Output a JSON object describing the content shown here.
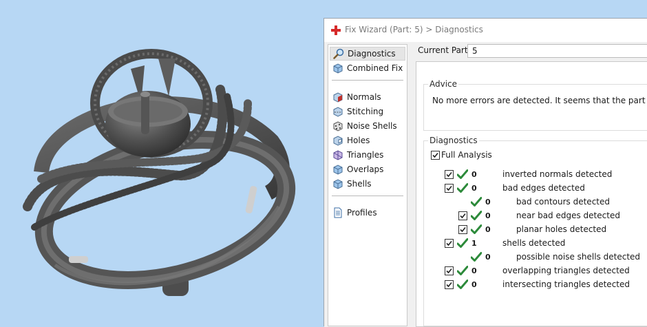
{
  "window": {
    "title": "Fix Wizard (Part: 5) > Diagnostics",
    "current_part_label": "Current Part:",
    "current_part_value": "5"
  },
  "sidebar": {
    "items": [
      {
        "label": "Diagnostics",
        "icon": "magnifier-icon",
        "selected": true
      },
      {
        "label": "Combined Fix",
        "icon": "cube-icon"
      },
      {
        "label": "Normals",
        "icon": "normals-cube-icon"
      },
      {
        "label": "Stitching",
        "icon": "stitching-cube-icon"
      },
      {
        "label": "Noise Shells",
        "icon": "noise-cube-icon"
      },
      {
        "label": "Holes",
        "icon": "holes-cube-icon"
      },
      {
        "label": "Triangles",
        "icon": "triangles-cube-icon"
      },
      {
        "label": "Overlaps",
        "icon": "overlaps-cube-icon"
      },
      {
        "label": "Shells",
        "icon": "shells-cube-icon"
      },
      {
        "label": "Profiles",
        "icon": "profile-document-icon"
      }
    ]
  },
  "advice": {
    "title": "Advice",
    "text": "No more errors are detected. It seems that the part is ok."
  },
  "diagnostics": {
    "title": "Diagnostics",
    "full_analysis_label": "Full Analysis",
    "full_analysis_checked": true,
    "rows": [
      {
        "count": "0",
        "label": "inverted normals detected",
        "checked": true,
        "indent": 0,
        "status": "ok"
      },
      {
        "count": "0",
        "label": "bad edges detected",
        "checked": true,
        "indent": 0,
        "status": "ok"
      },
      {
        "count": "0",
        "label": "bad contours detected",
        "checked": null,
        "indent": 1,
        "status": "ok"
      },
      {
        "count": "0",
        "label": "near bad edges detected",
        "checked": true,
        "indent": 1,
        "status": "ok"
      },
      {
        "count": "0",
        "label": "planar holes detected",
        "checked": true,
        "indent": 1,
        "status": "ok"
      },
      {
        "count": "1",
        "label": "shells detected",
        "checked": true,
        "indent": 0,
        "status": "ok"
      },
      {
        "count": "0",
        "label": "possible noise shells detected",
        "checked": null,
        "indent": 1,
        "status": "ok"
      },
      {
        "count": "0",
        "label": "overlapping triangles detected",
        "checked": true,
        "indent": 0,
        "status": "ok"
      },
      {
        "count": "0",
        "label": "intersecting triangles detected",
        "checked": true,
        "indent": 0,
        "status": "ok"
      }
    ]
  },
  "colors": {
    "viewport_background": "#b7d7f4",
    "model": "#5a5a5a",
    "ok_tick": "#2c8a3a",
    "title_icon": "#d62a2a"
  }
}
